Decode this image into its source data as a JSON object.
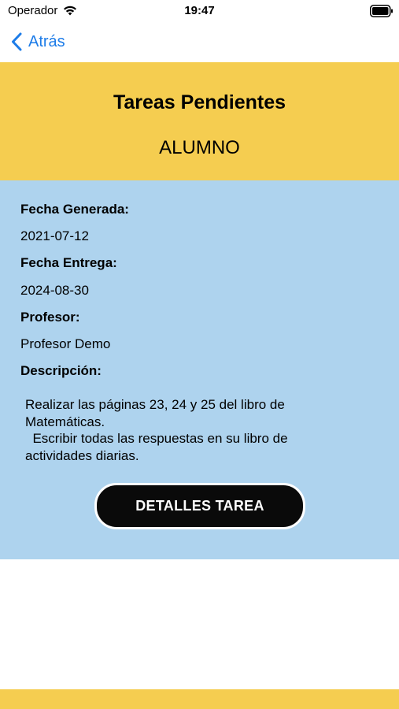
{
  "status_bar": {
    "carrier": "Operador",
    "time": "19:47",
    "wifi_icon": "wifi-icon",
    "battery_icon": "battery-icon"
  },
  "nav": {
    "back_label": "Atrás",
    "back_icon": "chevron-left-icon"
  },
  "header": {
    "title": "Tareas Pendientes",
    "role": "ALUMNO"
  },
  "task": {
    "fecha_generada_label": "Fecha Generada:",
    "fecha_generada_value": "2021-07-12",
    "fecha_entrega_label": "Fecha Entrega:",
    "fecha_entrega_value": "2024-08-30",
    "profesor_label": "Profesor:",
    "profesor_value": "Profesor Demo",
    "descripcion_label": "Descripción:",
    "descripcion_value": "Realizar las páginas 23, 24 y 25 del libro de Matemáticas.\n  Escribir todas las respuestas en su libro de actividades diarias."
  },
  "actions": {
    "details_button_label": "DETALLES TAREA"
  },
  "colors": {
    "header_yellow": "#f5cd50",
    "card_blue": "#aed3ee",
    "link_blue": "#1d7ce8",
    "button_black": "#0a0a0a"
  }
}
